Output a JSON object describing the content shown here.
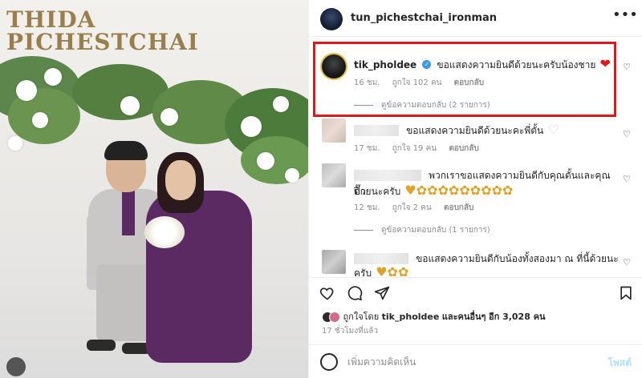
{
  "photo": {
    "title_line1": "THIDA",
    "title_line2": "PICHESTCHAI"
  },
  "post": {
    "author": "tun_pichestchai_ironman",
    "more_icon": "more-horizontal-icon"
  },
  "comments": [
    {
      "username": "tik_pholdee",
      "verified": true,
      "text": "ขอแสดงความยินดีด้วยนะครับน้องชาย",
      "emoji": "❤",
      "time": "16 ชม.",
      "likes": "ถูกใจ 102 คน",
      "reply": "ตอบกลับ",
      "view_replies": "ดูข้อความตอบกลับ (2 รายการ)"
    },
    {
      "username": "",
      "text": "ขอแสดงความยินดีด้วยนะคะพี่ตั้น",
      "emoji": "♡",
      "time": "17 ชม.",
      "likes": "ถูกใจ 19 คน",
      "reply": "ตอบกลับ"
    },
    {
      "username": "",
      "text_line1": "พวกเราขอแสดงความยินดีกับคุณตั้นและคุณปิ๊ก",
      "text_line2": "ด้วยนะครับ",
      "emoji": "♥✿✿✿✿✿✿✿✿✿",
      "time": "12 ชม.",
      "likes": "ถูกใจ 2 คน",
      "reply": "ตอบกลับ",
      "view_replies": "ดูข้อความตอบกลับ (1 รายการ)"
    },
    {
      "username": "",
      "text_line1": "ขอแสดงความยินดีกับน้องทั้งสองมา ณ ที่นี้ด้วยนะ",
      "text_line2": "ครับ",
      "emoji": "♥✿✿"
    }
  ],
  "likes_summary": {
    "prefix": "ถูกใจโดย",
    "user": "tik_pholdee",
    "middle": "และคนอื่นๆ",
    "suffix": "อีก 3,028 คน"
  },
  "time_ago": "17 ชั่วโมงที่แล้ว",
  "add_comment": {
    "placeholder": "เพิ่มความคิดเห็น",
    "post_label": "โพสต์"
  },
  "colors": {
    "highlight": "#e0161b",
    "verified": "#3897f0",
    "post_button": "#b2dffc"
  }
}
